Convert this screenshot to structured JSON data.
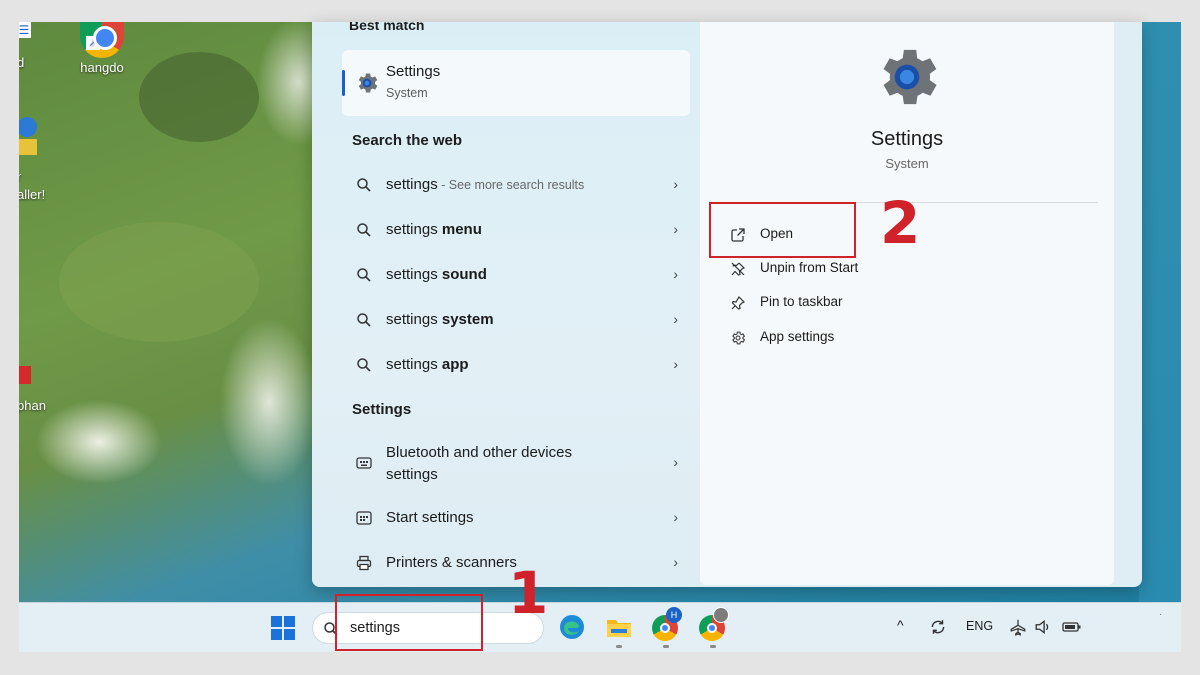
{
  "desktop": {
    "icons": [
      {
        "label": "hangdo"
      },
      {
        "label": "d"
      },
      {
        "label": "r"
      },
      {
        "label": "aller!"
      },
      {
        "label": "phan"
      }
    ]
  },
  "start_menu": {
    "best_match": {
      "heading": "Best match",
      "title": "Settings",
      "subtitle": "System"
    },
    "web": {
      "heading": "Search the web",
      "items": [
        {
          "prefix": "settings",
          "bold": "",
          "suffix": " - See more search results"
        },
        {
          "prefix": "settings ",
          "bold": "menu",
          "suffix": ""
        },
        {
          "prefix": "settings ",
          "bold": "sound",
          "suffix": ""
        },
        {
          "prefix": "settings ",
          "bold": "system",
          "suffix": ""
        },
        {
          "prefix": "settings ",
          "bold": "app",
          "suffix": ""
        }
      ]
    },
    "settings_section": {
      "heading": "Settings",
      "items": [
        {
          "label": "Bluetooth and other devices settings"
        },
        {
          "label": "Start settings"
        },
        {
          "label": "Printers & scanners"
        }
      ]
    },
    "detail": {
      "title": "Settings",
      "subtitle": "System",
      "actions": [
        {
          "label": "Open",
          "icon": "open-external-icon"
        },
        {
          "label": "Unpin from Start",
          "icon": "unpin-icon"
        },
        {
          "label": "Pin to taskbar",
          "icon": "pin-icon"
        },
        {
          "label": "App settings",
          "icon": "gear-icon"
        }
      ]
    }
  },
  "annotations": {
    "step1": "1",
    "step2": "2"
  },
  "taskbar": {
    "search_value": "settings",
    "apps": [
      "edge-icon",
      "file-explorer-icon",
      "chrome-profile-icon",
      "chrome-icon"
    ],
    "profile_badge": "H",
    "tray": {
      "language": "ENG"
    }
  },
  "colors": {
    "accent": "#1a62c4",
    "annotation": "#d0222a",
    "gear": "#6e7378"
  }
}
